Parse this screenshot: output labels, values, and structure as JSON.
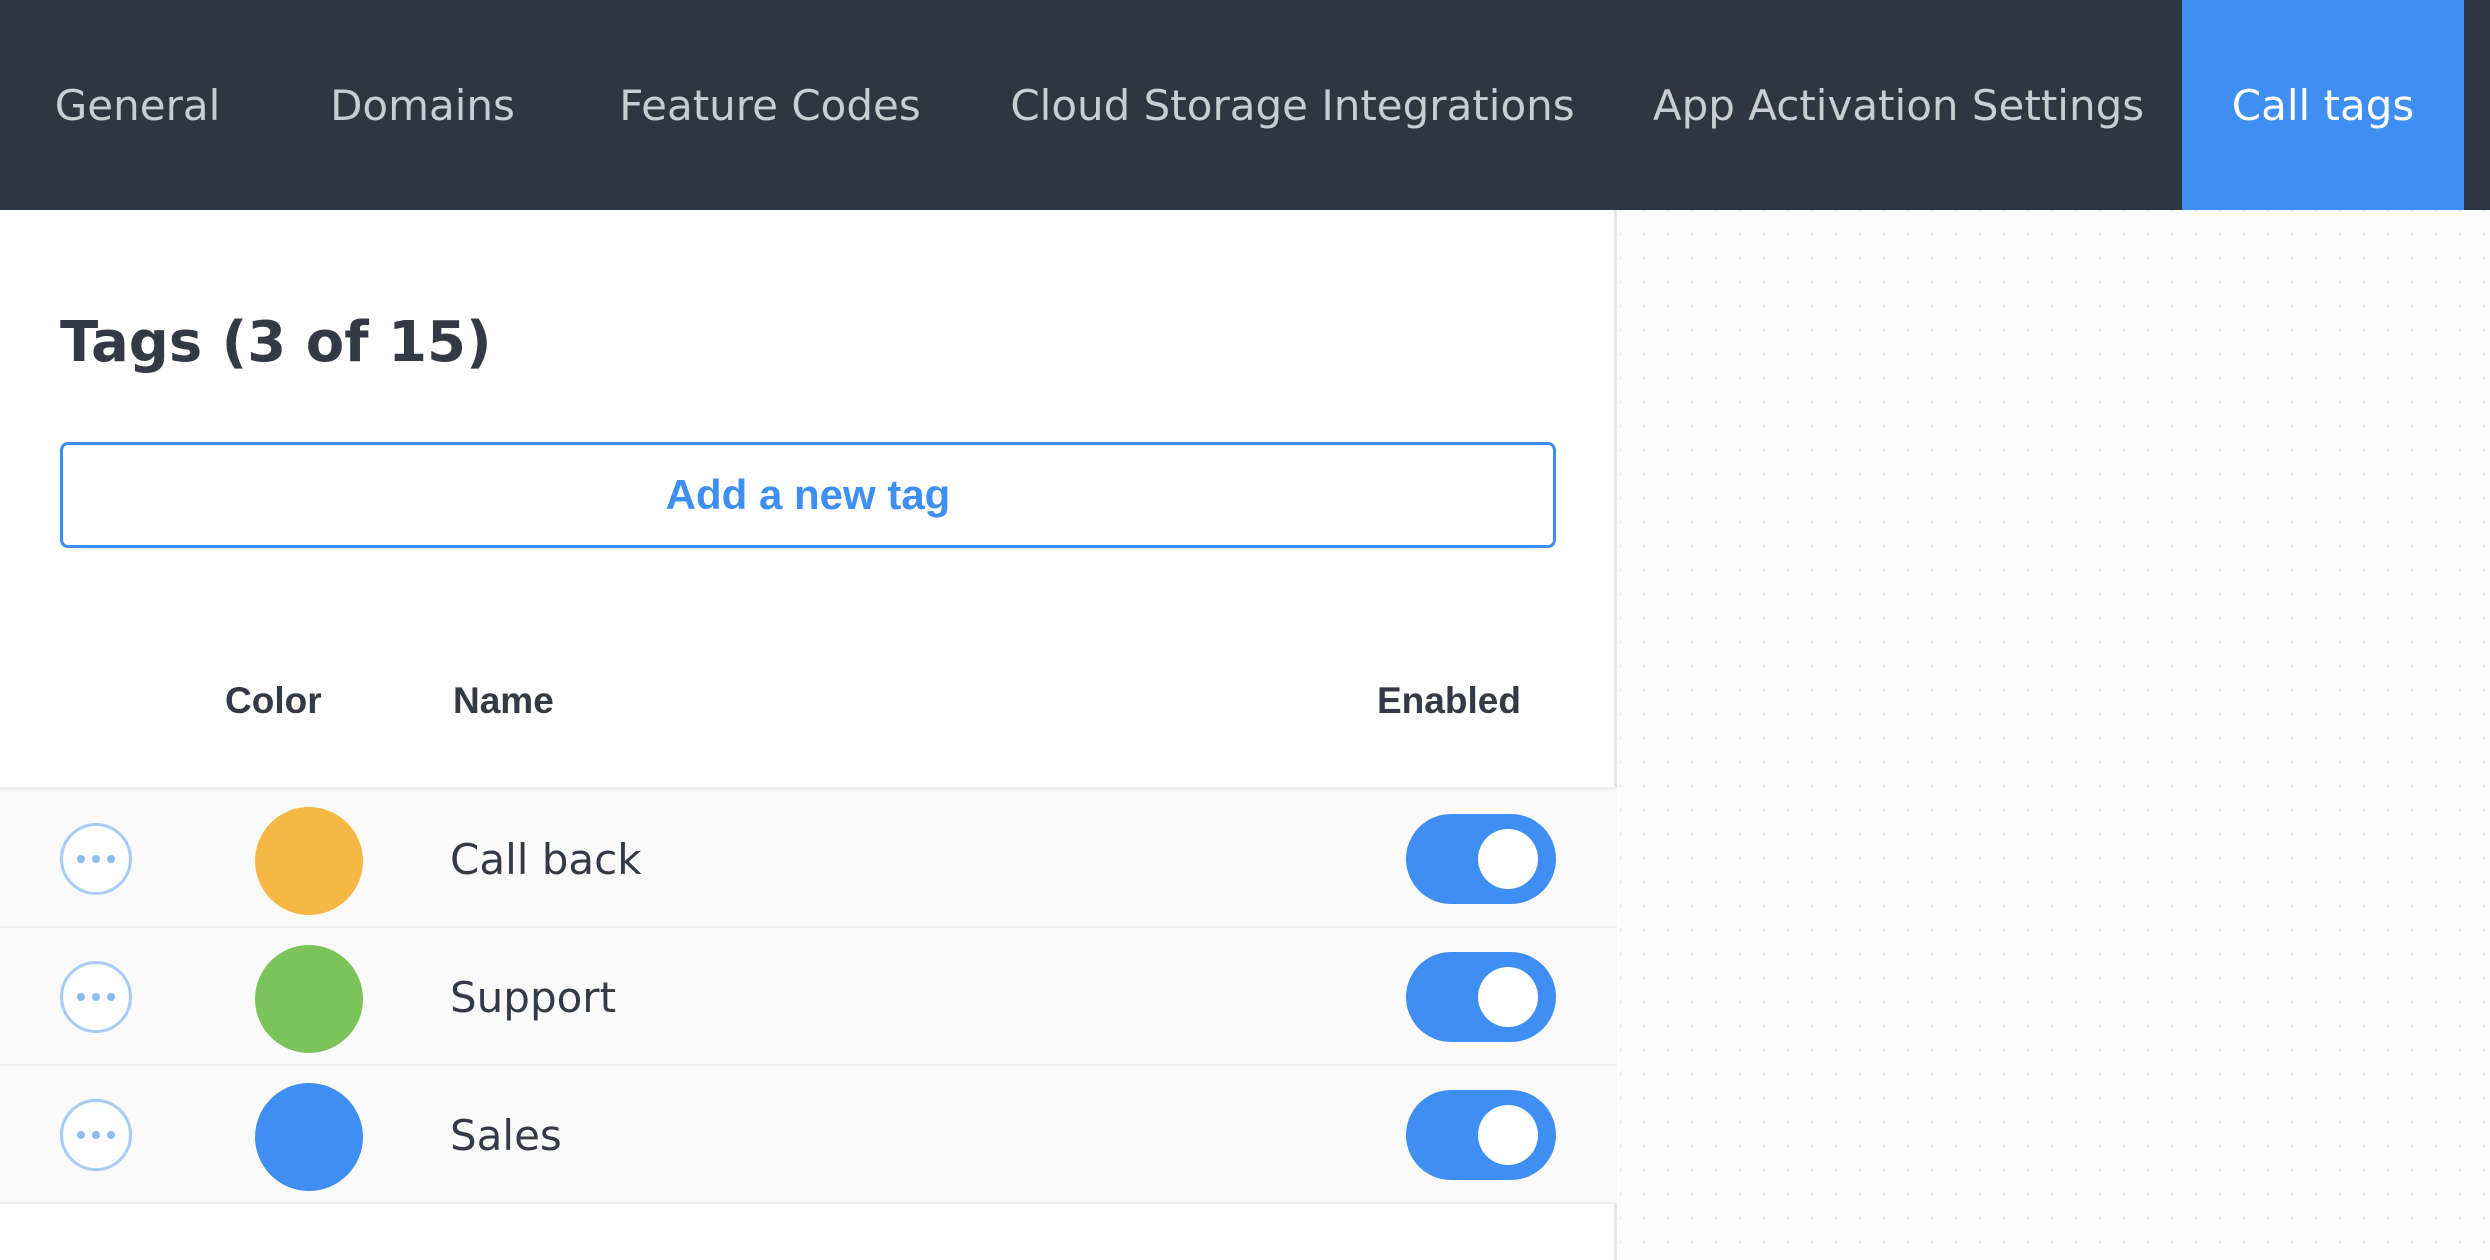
{
  "nav": {
    "tabs": [
      {
        "label": "General",
        "active": false
      },
      {
        "label": "Domains",
        "active": false
      },
      {
        "label": "Feature Codes",
        "active": false
      },
      {
        "label": "Cloud Storage Integrations",
        "active": false
      },
      {
        "label": "App Activation Settings",
        "active": false
      },
      {
        "label": "Call tags",
        "active": true
      }
    ]
  },
  "tags_panel": {
    "title": "Tags (3 of 15)",
    "add_button_label": "Add a new tag",
    "columns": {
      "color": "Color",
      "name": "Name",
      "enabled": "Enabled"
    },
    "rows": [
      {
        "name": "Call back",
        "color": "#f6b842",
        "enabled": true,
        "actions_icon": "more-horizontal-icon"
      },
      {
        "name": "Support",
        "color": "#7bc45a",
        "enabled": true,
        "actions_icon": "more-horizontal-icon"
      },
      {
        "name": "Sales",
        "color": "#3f8ef2",
        "enabled": true,
        "actions_icon": "more-horizontal-icon"
      }
    ]
  },
  "colors": {
    "nav_background": "#2f3541",
    "accent": "#3f8ef2",
    "text": "#343a45"
  }
}
